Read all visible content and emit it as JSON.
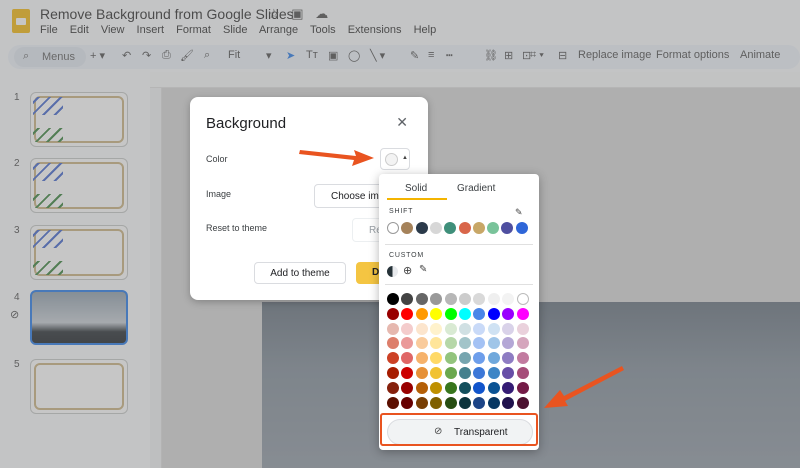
{
  "doc": {
    "title": "Remove Background from Google Slides",
    "title_icons": [
      "☆",
      "▣",
      "☁"
    ]
  },
  "menu": [
    "File",
    "Edit",
    "View",
    "Insert",
    "Format",
    "Slide",
    "Arrange",
    "Tools",
    "Extensions",
    "Help"
  ],
  "toolbar": {
    "search_label": "Menus",
    "zoom_label": "Fit",
    "replace_image": "Replace image",
    "format_options": "Format options",
    "animate": "Animate"
  },
  "thumbnails": [
    "1",
    "2",
    "3",
    "4",
    "5"
  ],
  "dialog": {
    "title": "Background",
    "color_label": "Color",
    "image_label": "Image",
    "reset_label": "Reset to theme",
    "choose_image": "Choose ima",
    "reset_button": "Re",
    "add_to_theme": "Add to theme",
    "done": "D"
  },
  "picker": {
    "tab_solid": "Solid",
    "tab_gradient": "Gradient",
    "shift_label": "SHIFT",
    "custom_label": "CUSTOM",
    "transparent": "Transparent",
    "theme_colors": [
      "#ffffff",
      "#a5825a",
      "#2b3a4a",
      "#d7d7d7",
      "#3f8f7a",
      "#d9664a",
      "#c8a767",
      "#79c39a",
      "#4f4fa0",
      "#2f66d8"
    ],
    "grid_rows": [
      [
        "#000000",
        "#434343",
        "#666666",
        "#999999",
        "#b7b7b7",
        "#cccccc",
        "#d9d9d9",
        "#efefef",
        "#f3f3f3",
        "#ffffff"
      ],
      [
        "#980000",
        "#ff0000",
        "#ff9900",
        "#ffff00",
        "#00ff00",
        "#00ffff",
        "#4a86e8",
        "#0000ff",
        "#9900ff",
        "#ff00ff"
      ],
      [
        "#e6b8af",
        "#f4cccc",
        "#fce5cd",
        "#fff2cc",
        "#d9ead3",
        "#d0e0e3",
        "#c9daf8",
        "#cfe2f3",
        "#d9d2e9",
        "#ead1dc"
      ],
      [
        "#dd7e6b",
        "#ea9999",
        "#f9cb9c",
        "#ffe599",
        "#b6d7a8",
        "#a2c4c9",
        "#a4c2f4",
        "#9fc5e8",
        "#b4a7d6",
        "#d5a6bd"
      ],
      [
        "#cc4125",
        "#e06666",
        "#f6b26b",
        "#ffd966",
        "#93c47d",
        "#76a5af",
        "#6d9eeb",
        "#6fa8dc",
        "#8e7cc3",
        "#c27ba0"
      ],
      [
        "#a61c00",
        "#cc0000",
        "#e69138",
        "#f1c232",
        "#6aa84f",
        "#45818e",
        "#3c78d8",
        "#3d85c6",
        "#674ea7",
        "#a64d79"
      ],
      [
        "#85200c",
        "#990000",
        "#b45f06",
        "#bf9000",
        "#38761d",
        "#134f5c",
        "#1155cc",
        "#0b5394",
        "#351c75",
        "#741b47"
      ],
      [
        "#5b0f00",
        "#660000",
        "#783f04",
        "#7f6000",
        "#274e13",
        "#0c343d",
        "#1c4587",
        "#073763",
        "#20124d",
        "#4c1130"
      ]
    ]
  },
  "colors": {
    "accent_yellow": "#f4b400",
    "annotation_orange": "#e95420"
  }
}
